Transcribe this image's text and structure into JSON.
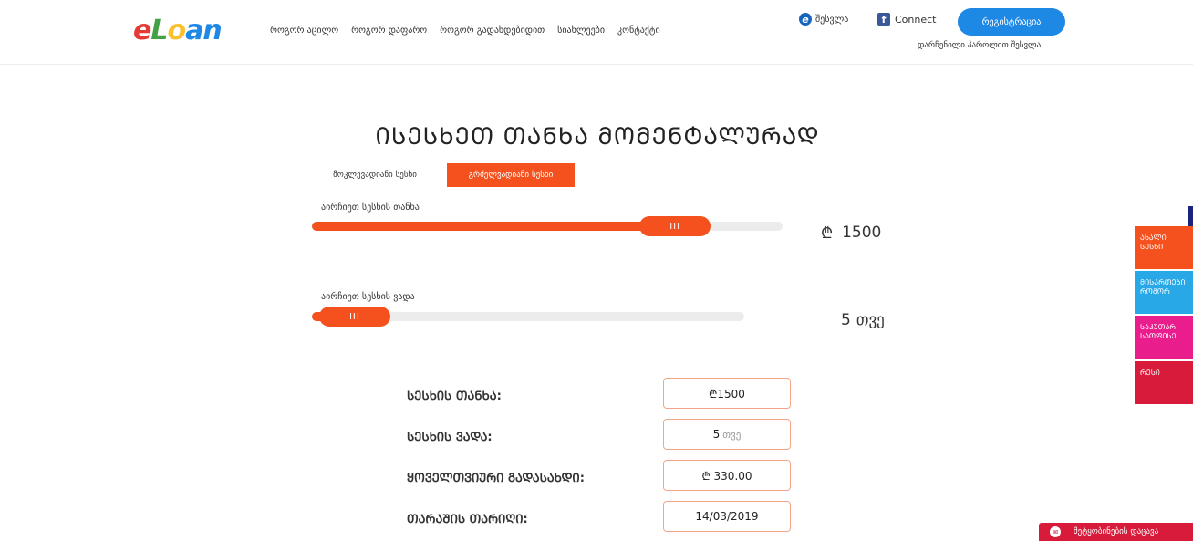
{
  "header": {
    "logo": {
      "part1": "e",
      "part2": "L",
      "part3": "o",
      "part4": "an"
    },
    "nav": [
      "როგორ აცილო",
      "როგორ დაფარო",
      "როგორ გადახდებიდით",
      "სიახლეები",
      "კონტაქტი"
    ],
    "login_label": "შესვლა",
    "login_icon": "e",
    "facebook_icon": "f",
    "facebook_label": "Connect",
    "register_label": "რეგისტრაცია",
    "forgot_label": "დარჩენილი პაროლით შესვლა"
  },
  "main": {
    "title": "ᲘᲡᲔᲡᲮᲔᲗ ᲗᲐᲜᲮᲐ ᲛᲝᲛᲔᲜᲢᲐᲚᲣᲠᲐᲓ",
    "tabs": {
      "consumer": "მოკლევადიანი სესხი",
      "business": "გრძელვადიანი სესხი"
    },
    "amount_slider": {
      "label": "აირჩიეთ სესხის თანხა",
      "handle": "III",
      "currency_symbol": "₾",
      "value": "1500",
      "fill_fraction": 0.82
    },
    "duration_slider": {
      "label": "აირჩიეთ სესხის ვადა",
      "handle": "III",
      "value": "5",
      "unit": "თვე",
      "fill_fraction": 0.02
    },
    "summary": {
      "amount_label": "ᲡᲔᲡᲮᲘᲡ ᲗᲐᲜᲮᲐ:",
      "amount_value": "₾1500",
      "term_label": "ᲡᲔᲡᲮᲘᲡ ᲕᲐᲓᲐ:",
      "term_value": "5",
      "term_unit": "თვე",
      "monthly_label": "ᲧᲝᲕᲔᲚᲗᲕᲘᲣᲠᲘ ᲒᲐᲓᲐᲡᲐᲮᲓᲘ:",
      "monthly_value": "₾ 330.00",
      "date_label": "ᲗᲐᲠᲐᲨᲘᲡ ᲗᲐᲠᲘᲦᲘ:",
      "date_value": "14/03/2019"
    }
  },
  "side_buttons": [
    {
      "label": "ᲐᲮᲐᲚᲘ ᲡᲔᲡᲮᲘ",
      "color": "#f4511e"
    },
    {
      "label": "ᲛᲘᲡᲐᲠᲗᲔᲑᲘ ᲠᲝᲒᲝᲠ",
      "color": "#29a8e8"
    },
    {
      "label": "ᲡᲐᲙᲣᲗᲐᲠ ᲡᲐᲝᲤᲘᲡᲔ",
      "color": "#e91e8c"
    },
    {
      "label": "ᲠᲔᲡᲘ",
      "color": "#d81b3a"
    }
  ],
  "subscribe": {
    "label": "შეტყობინების დაცავა",
    "icon": "✉"
  },
  "colors": {
    "accent": "#f4511e",
    "brand_blue": "#1e88e5",
    "facebook": "#3b5998"
  }
}
